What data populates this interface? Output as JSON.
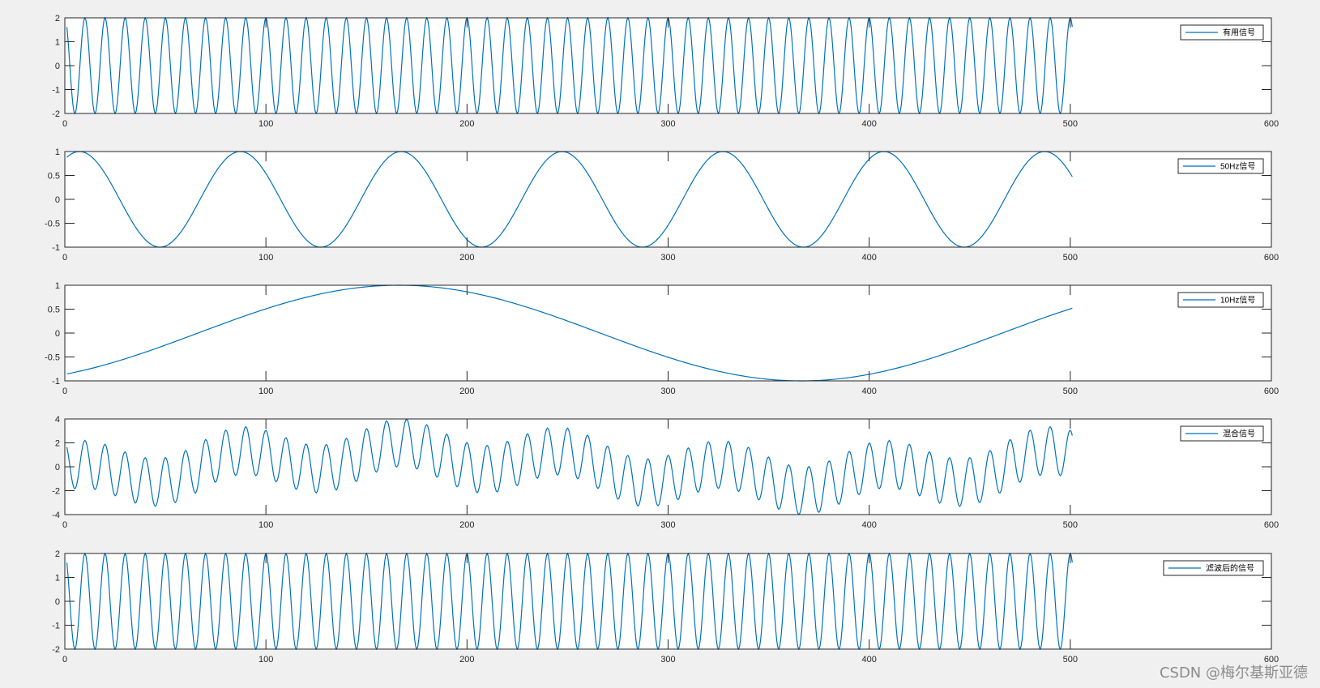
{
  "figure": {
    "background": "#f0f0f0",
    "axes_background": "#ffffff",
    "axes_color": "#262626",
    "line_color": "#0072bd",
    "watermark": "CSDN @梅尔基斯亚德"
  },
  "chart_data": [
    {
      "type": "line",
      "title": "",
      "xlabel": "",
      "ylabel": "",
      "xlim": [
        0,
        600
      ],
      "ylim": [
        -2,
        2
      ],
      "xticks": [
        0,
        100,
        200,
        300,
        400,
        500,
        600
      ],
      "yticks": [
        2,
        1,
        0,
        -1,
        -2
      ],
      "grid": false,
      "legend_position": "top-right",
      "series": [
        {
          "name": "有用信号",
          "function": "2*cos(2*pi*0.1*n)",
          "x_start": 1,
          "x_end": 501,
          "x_step": 0.5
        }
      ]
    },
    {
      "type": "line",
      "title": "",
      "xlabel": "",
      "ylabel": "",
      "xlim": [
        0,
        600
      ],
      "ylim": [
        -1,
        1
      ],
      "xticks": [
        0,
        100,
        200,
        300,
        400,
        500,
        600
      ],
      "yticks": [
        1,
        0.5,
        0,
        -0.5,
        -1
      ],
      "grid": false,
      "legend_position": "top-right",
      "series": [
        {
          "name": "50Hz信号",
          "function": "sin(2*pi*0.0125*n + 1)",
          "x_start": 1,
          "x_end": 501,
          "x_step": 1
        }
      ]
    },
    {
      "type": "line",
      "title": "",
      "xlabel": "",
      "ylabel": "",
      "xlim": [
        0,
        600
      ],
      "ylim": [
        -1,
        1
      ],
      "xticks": [
        0,
        100,
        200,
        300,
        400,
        500,
        600
      ],
      "yticks": [
        1,
        0.5,
        0,
        -0.5,
        -1
      ],
      "grid": false,
      "legend_position": "top-right",
      "series": [
        {
          "name": "10Hz信号",
          "function": "sin(2*pi*0.0025*n - 1.04)",
          "x_start": 1,
          "x_end": 501,
          "x_step": 1
        }
      ]
    },
    {
      "type": "line",
      "title": "",
      "xlabel": "",
      "ylabel": "",
      "xlim": [
        0,
        600
      ],
      "ylim": [
        -4,
        4
      ],
      "xticks": [
        0,
        100,
        200,
        300,
        400,
        500,
        600
      ],
      "yticks": [
        4,
        2,
        0,
        -2,
        -4
      ],
      "grid": false,
      "legend_position": "top-right",
      "series": [
        {
          "name": "混合信号",
          "function": "有用信号 + 50Hz信号 + 10Hz信号",
          "x_start": 1,
          "x_end": 501,
          "x_step": 0.5
        }
      ]
    },
    {
      "type": "line",
      "title": "",
      "xlabel": "",
      "ylabel": "",
      "xlim": [
        0,
        600
      ],
      "ylim": [
        -2,
        2
      ],
      "xticks": [
        0,
        100,
        200,
        300,
        400,
        500,
        600
      ],
      "yticks": [
        2,
        1,
        0,
        -1,
        -2
      ],
      "grid": false,
      "legend_position": "top-right",
      "series": [
        {
          "name": "滤波后的信号",
          "function": "2*cos(2*pi*0.1*n)",
          "x_start": 1,
          "x_end": 501,
          "x_step": 0.5
        }
      ]
    }
  ]
}
